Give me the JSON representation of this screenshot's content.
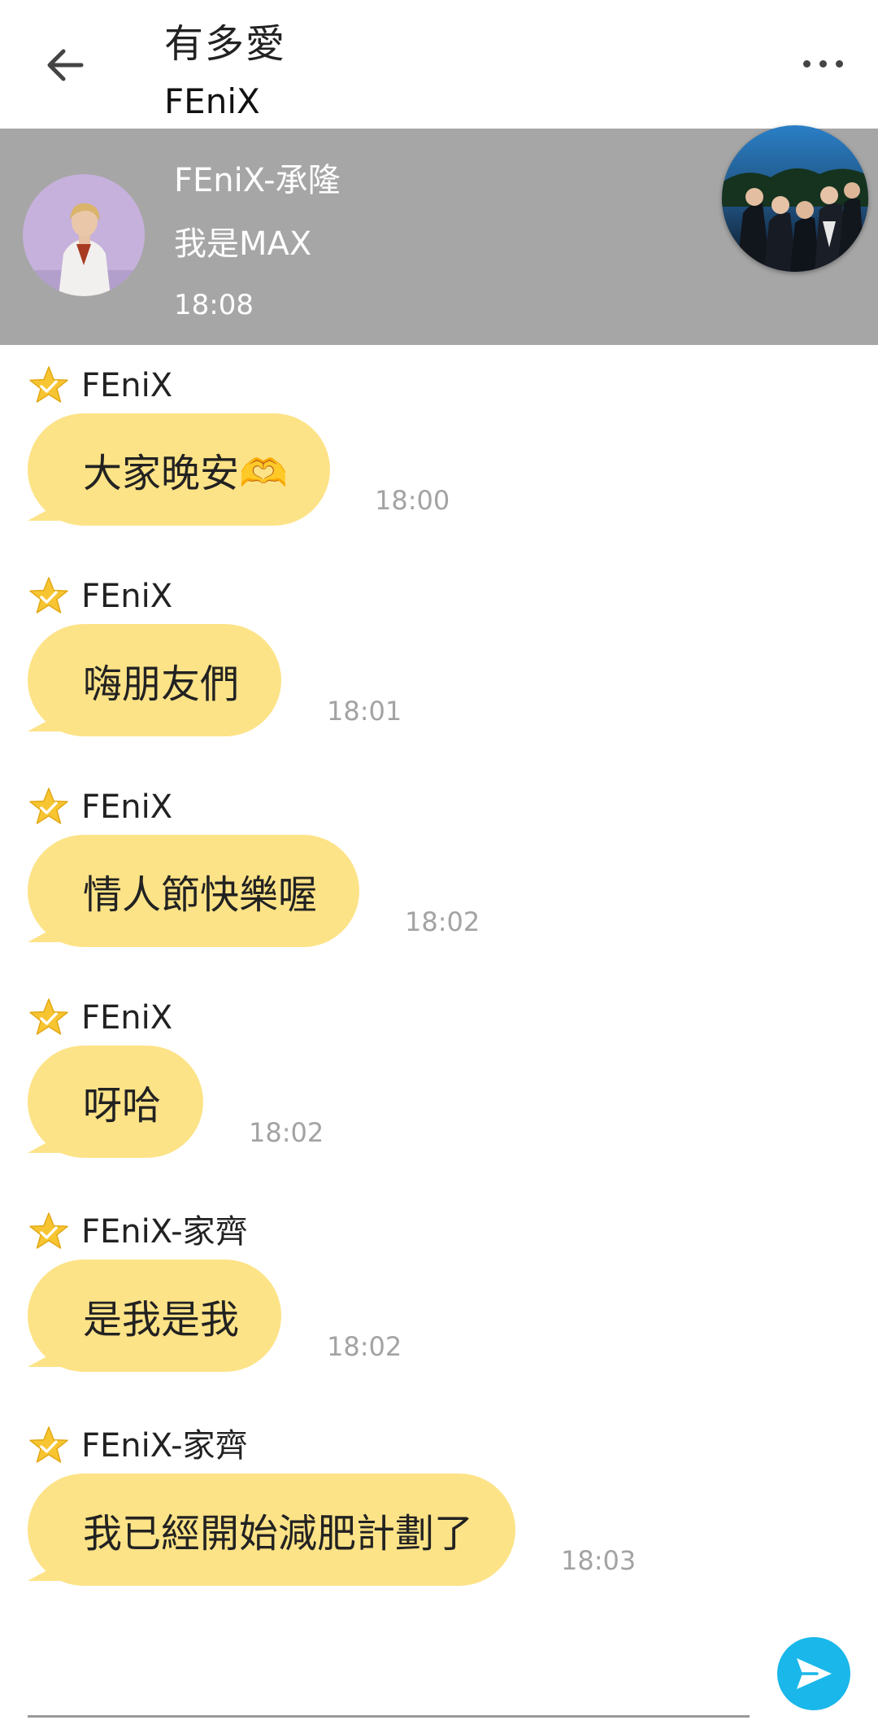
{
  "header": {
    "title": "有多愛",
    "subtitle": "FEniX",
    "back_icon": "arrow-left-icon",
    "more_icon": "more-horizontal-icon"
  },
  "pinned": {
    "sender": "FEniX-承隆",
    "message": "我是MAX",
    "time": "18:08"
  },
  "messages": [
    {
      "sender": "FEniX",
      "text": "大家晚安🫶",
      "time": "18:00"
    },
    {
      "sender": "FEniX",
      "text": "嗨朋友們",
      "time": "18:01"
    },
    {
      "sender": "FEniX",
      "text": "情人節快樂喔",
      "time": "18:02"
    },
    {
      "sender": "FEniX",
      "text": "呀哈",
      "time": "18:02"
    },
    {
      "sender": "FEniX-家齊",
      "text": "是我是我",
      "time": "18:02"
    },
    {
      "sender": "FEniX-家齊",
      "text": "我已經開始減肥計劃了",
      "time": "18:03"
    }
  ],
  "input": {
    "value": "",
    "send_icon": "send-icon"
  },
  "colors": {
    "bubble": "#fde387",
    "pinned_bg": "#a6a6a6",
    "send_button": "#1ab7ea",
    "star": "#f7c531",
    "timestamp": "#a3a3a3"
  }
}
